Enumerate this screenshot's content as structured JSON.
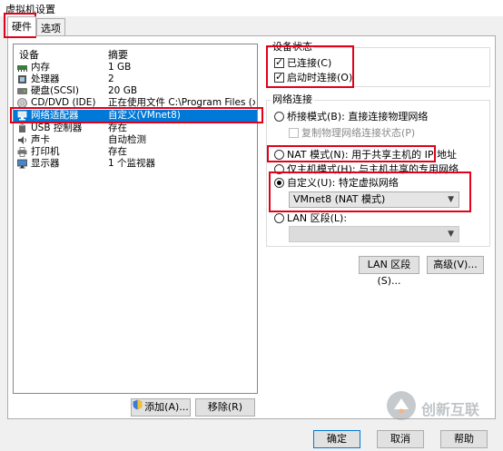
{
  "window": {
    "title": "虚拟机设置"
  },
  "tabs": [
    {
      "label": "硬件"
    },
    {
      "label": "选项"
    }
  ],
  "device_list": {
    "col_device": "设备",
    "col_summary": "摘要",
    "rows": [
      {
        "device": "内存",
        "summary": "1 GB",
        "icon": "memory-icon"
      },
      {
        "device": "处理器",
        "summary": "2",
        "icon": "processor-icon"
      },
      {
        "device": "硬盘(SCSI)",
        "summary": "20 GB",
        "icon": "hard-disk-icon"
      },
      {
        "device": "CD/DVD (IDE)",
        "summary": "正在使用文件 C:\\Program Files (x86...",
        "icon": "cd-dvd-icon"
      },
      {
        "device": "网络适配器",
        "summary": "自定义(VMnet8)",
        "icon": "network-adapter-icon"
      },
      {
        "device": "USB 控制器",
        "summary": "存在",
        "icon": "usb-icon"
      },
      {
        "device": "声卡",
        "summary": "自动检测",
        "icon": "sound-card-icon"
      },
      {
        "device": "打印机",
        "summary": "存在",
        "icon": "printer-icon"
      },
      {
        "device": "显示器",
        "summary": "1 个监视器",
        "icon": "display-icon"
      }
    ],
    "add_button": "添加(A)...",
    "remove_button": "移除(R)"
  },
  "device_status": {
    "title": "设备状态",
    "connected": "已连接(C)",
    "connect_at_power_on": "启动时连接(O)"
  },
  "network_connection": {
    "title": "网络连接",
    "bridged": "桥接模式(B): 直接连接物理网络",
    "replicate": "复制物理网络连接状态(P)",
    "nat": "NAT 模式(N): 用于共享主机的 IP 地址",
    "host_only": "仅主机模式(H): 与主机共享的专用网络",
    "custom": "自定义(U): 特定虚拟网络",
    "custom_value": "VMnet8 (NAT 模式)",
    "lan_segment": "LAN 区段(L):",
    "lan_segment_value": ""
  },
  "buttons": {
    "lan_segments": "LAN 区段(S)...",
    "advanced": "高级(V)...",
    "ok": "确定",
    "cancel": "取消",
    "help": "帮助"
  },
  "watermark": {
    "text": "创新互联"
  },
  "colors": {
    "selection": "#0078d7",
    "annotation": "#e2001a"
  }
}
